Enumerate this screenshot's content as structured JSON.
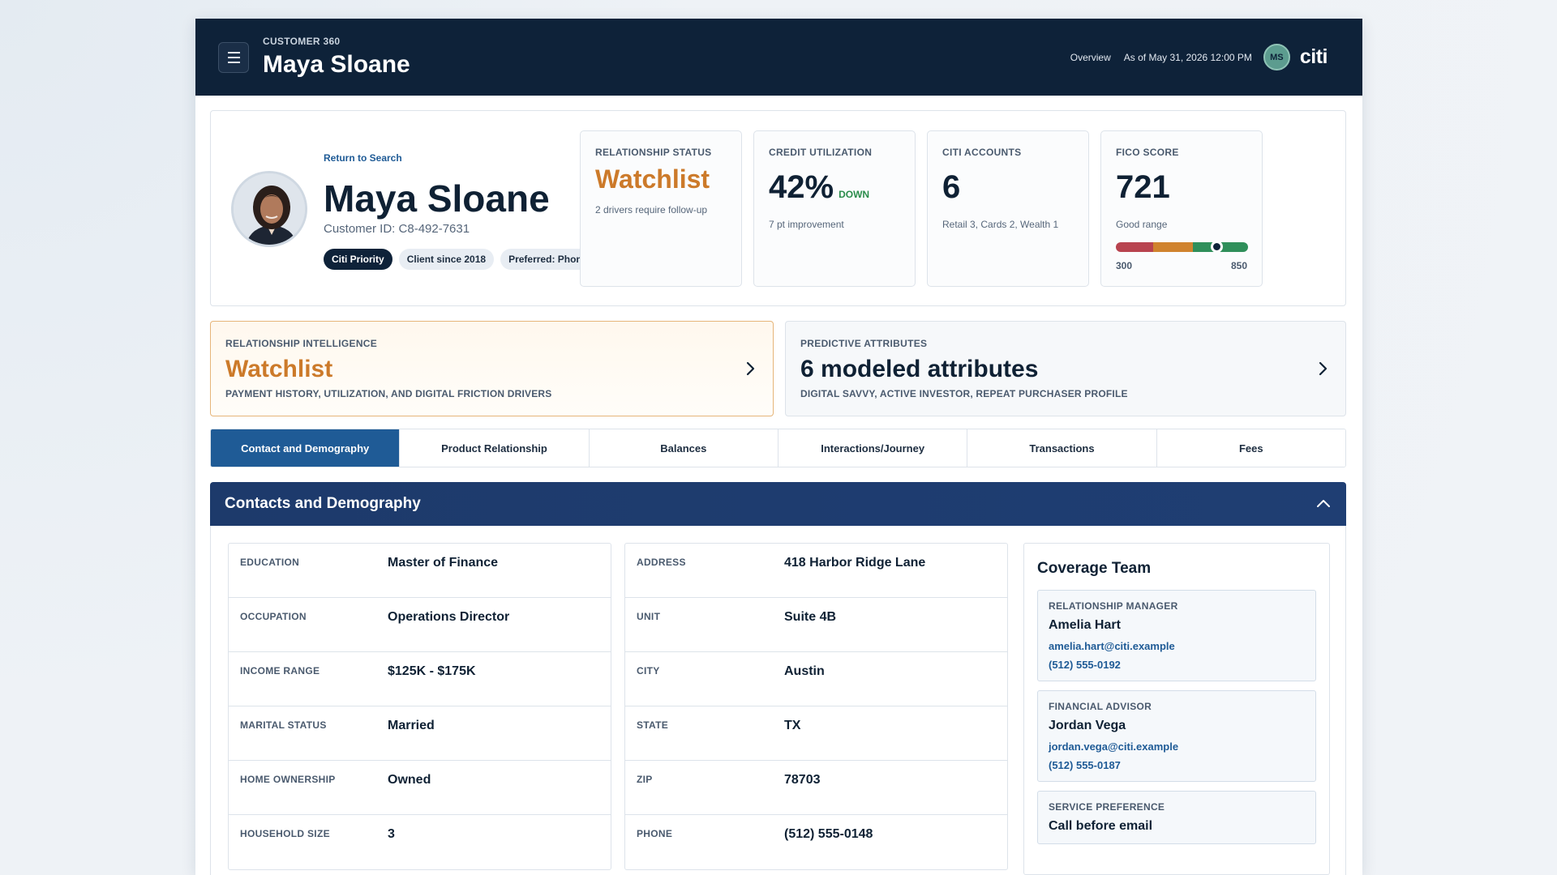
{
  "header": {
    "kicker": "CUSTOMER 360",
    "title": "Maya Sloane",
    "overview_link": "Overview",
    "as_of": "As of May 31, 2026 12:00 PM",
    "user_initials": "MS",
    "logo_text": "citi",
    "menu_icon": "hamburger-menu-icon"
  },
  "profile": {
    "return_link": "Return to Search",
    "name": "Maya Sloane",
    "customer_id": "Customer ID: C8-492-7631",
    "chips": [
      "Citi Priority",
      "Client since 2018",
      "Preferred: Phone"
    ]
  },
  "stats": {
    "relationship": {
      "label": "RELATIONSHIP STATUS",
      "value": "Watchlist",
      "note": "2 drivers require follow-up",
      "color": "#cc7a2a"
    },
    "credit": {
      "label": "CREDIT UTILIZATION",
      "value": "42%",
      "trend": "DOWN",
      "note": "7 pt improvement"
    },
    "accounts": {
      "label": "CITI ACCOUNTS",
      "value": "6",
      "note": "Retail 3, Cards 2, Wealth 1"
    },
    "fico": {
      "label": "FICO SCORE",
      "value": "721",
      "note": "Good range",
      "min": "300",
      "max": "850",
      "score": 721
    }
  },
  "insights": {
    "intelligence": {
      "label": "RELATIONSHIP INTELLIGENCE",
      "title": "Watchlist",
      "sub": "PAYMENT HISTORY, UTILIZATION, AND DIGITAL FRICTION DRIVERS"
    },
    "predictive": {
      "label": "PREDICTIVE ATTRIBUTES",
      "title": "6 modeled attributes",
      "sub": "DIGITAL SAVVY, ACTIVE INVESTOR, REPEAT PURCHASER PROFILE"
    }
  },
  "tabs": [
    {
      "label": "Contact and Demography",
      "active": true
    },
    {
      "label": "Product Relationship"
    },
    {
      "label": "Balances"
    },
    {
      "label": "Interactions/Journey"
    },
    {
      "label": "Transactions"
    },
    {
      "label": "Fees"
    }
  ],
  "section": {
    "title": "Contacts and Demography",
    "demography": [
      {
        "key": "EDUCATION",
        "value": "Master of Finance"
      },
      {
        "key": "OCCUPATION",
        "value": "Operations Director"
      },
      {
        "key": "INCOME RANGE",
        "value": "$125K - $175K"
      },
      {
        "key": "MARITAL STATUS",
        "value": "Married"
      },
      {
        "key": "HOME OWNERSHIP",
        "value": "Owned"
      },
      {
        "key": "HOUSEHOLD SIZE",
        "value": "3"
      }
    ],
    "contact": [
      {
        "key": "ADDRESS",
        "value": "418 Harbor Ridge Lane"
      },
      {
        "key": "UNIT",
        "value": "Suite 4B"
      },
      {
        "key": "CITY",
        "value": "Austin"
      },
      {
        "key": "STATE",
        "value": "TX"
      },
      {
        "key": "ZIP",
        "value": "78703"
      },
      {
        "key": "PHONE",
        "value": "(512) 555-0148"
      }
    ],
    "coverage": {
      "title": "Coverage Team",
      "manager": {
        "role": "RELATIONSHIP MANAGER",
        "name": "Amelia Hart",
        "email": "amelia.hart@citi.example",
        "phone": "(512) 555-0192"
      },
      "advisor": {
        "role": "FINANCIAL ADVISOR",
        "name": "Jordan Vega",
        "email": "jordan.vega@citi.example",
        "phone": "(512) 555-0187"
      },
      "preference": {
        "role": "SERVICE PREFERENCE",
        "value": "Call before email"
      }
    }
  },
  "colors": {
    "navy": "#0e2239",
    "accent_blue": "#1f5b96",
    "watch_orange": "#cc7a2a",
    "trend_green": "#2a8c4a",
    "fico_red": "#b8434f",
    "fico_orange": "#d0832e",
    "fico_green": "#2f8f5a"
  }
}
